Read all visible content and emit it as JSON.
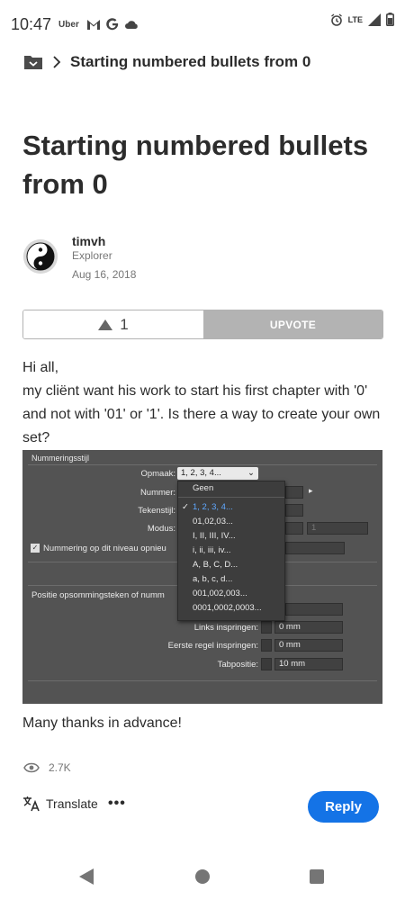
{
  "status_bar": {
    "time": "10:47",
    "app_label": "Uber",
    "network": "LTE"
  },
  "breadcrumb": {
    "text": "Starting numbered bullets from 0"
  },
  "post": {
    "title": "Starting numbered bullets from 0",
    "author": {
      "name": "timvh",
      "role": "Explorer",
      "date": "Aug 16, 2018"
    },
    "upvote": {
      "count": "1",
      "label": "UPVOTE"
    },
    "body_lines": [
      "Hi all,",
      "my cliënt want his work to start his first chapter with '0' and not with '01' or '1'. Is there a way to create your own set?"
    ],
    "closing": "Many thanks in advance!",
    "views": "2.7K"
  },
  "embed": {
    "header": "Nummeringsstijl",
    "opmaak_label": "Opmaak:",
    "opmaak_value": "1, 2, 3, 4...",
    "nummer_label": "Nummer:",
    "tekenstijl_label": "Tekenstijl:",
    "modus_label": "Modus:",
    "modus_value": "1",
    "checkbox_label": "Nummering op dit niveau opnieu",
    "positie_label": "Positie opsommingsteken of numm",
    "links_label": "Links inspringen:",
    "links_value": "0 mm",
    "eerste_label": "Eerste regel inspringen:",
    "eerste_value": "0 mm",
    "tab_label": "Tabpositie:",
    "tab_value": "10 mm",
    "dropdown_items": [
      "Geen",
      "1, 2, 3, 4...",
      "01,02,03...",
      "I, II, III, IV...",
      "i, ii, iii, iv...",
      "A, B, C, D...",
      "a, b, c, d...",
      "001,002,003...",
      "0001,0002,0003..."
    ]
  },
  "actions": {
    "translate": "Translate",
    "more": "•••",
    "reply": "Reply"
  },
  "colors": {
    "accent": "#1473e6",
    "upvote_bg": "#b3b3b3",
    "text": "#2c2c2c",
    "muted": "#777777"
  }
}
